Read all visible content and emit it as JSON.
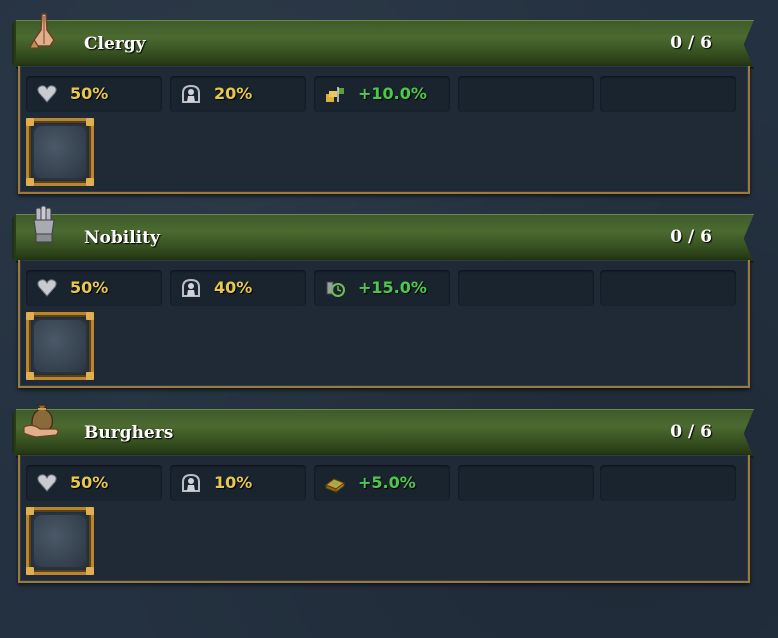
{
  "estates": [
    {
      "name": "Clergy",
      "count": "0 / 6",
      "icon": "praying-hands-icon",
      "loyalty": "50%",
      "influence": "20%",
      "bonus": "+10.0%",
      "bonus_icon": "clergy-bonus-icon"
    },
    {
      "name": "Nobility",
      "count": "0 / 6",
      "icon": "gauntlet-icon",
      "loyalty": "50%",
      "influence": "40%",
      "bonus": "+15.0%",
      "bonus_icon": "nobility-bonus-icon"
    },
    {
      "name": "Burghers",
      "count": "0 / 6",
      "icon": "money-bag-icon",
      "loyalty": "50%",
      "influence": "10%",
      "bonus": "+5.0%",
      "bonus_icon": "burghers-bonus-icon"
    }
  ],
  "colors": {
    "loyalty_value": "#e8c84a",
    "bonus_value": "#4cc84a",
    "banner": "#4b6a30",
    "frame_gold": "#b8862e"
  }
}
